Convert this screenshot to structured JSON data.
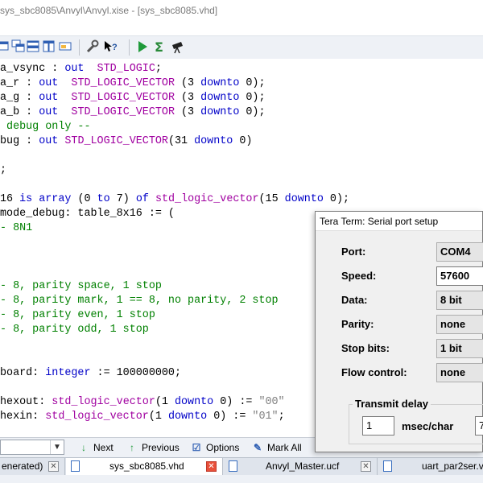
{
  "window": {
    "title": "sys_sbc8085\\Anvyl\\Anvyl.xise - [sys_sbc8085.vhd]"
  },
  "toolbar": {
    "icons": [
      "cascade-windows-icon",
      "tile-horizontal-icon",
      "tile-vertical-icon",
      "arrange-icon",
      "settings-wrench-icon",
      "help-pointer-icon",
      "run-icon",
      "sigma-icon",
      "telescope-icon"
    ]
  },
  "code": {
    "lines": [
      [
        {
          "t": "a_vsync : ",
          "c": "plain"
        },
        {
          "t": "out",
          "c": "kw"
        },
        {
          "t": "  ",
          "c": "plain"
        },
        {
          "t": "STD_LOGIC",
          "c": "ty"
        },
        {
          "t": ";",
          "c": "plain"
        }
      ],
      [
        {
          "t": "a_r : ",
          "c": "plain"
        },
        {
          "t": "out",
          "c": "kw"
        },
        {
          "t": "  ",
          "c": "plain"
        },
        {
          "t": "STD_LOGIC_VECTOR",
          "c": "ty"
        },
        {
          "t": " (3 ",
          "c": "plain"
        },
        {
          "t": "downto",
          "c": "kw"
        },
        {
          "t": " 0);",
          "c": "plain"
        }
      ],
      [
        {
          "t": "a_g : ",
          "c": "plain"
        },
        {
          "t": "out",
          "c": "kw"
        },
        {
          "t": "  ",
          "c": "plain"
        },
        {
          "t": "STD_LOGIC_VECTOR",
          "c": "ty"
        },
        {
          "t": " (3 ",
          "c": "plain"
        },
        {
          "t": "downto",
          "c": "kw"
        },
        {
          "t": " 0);",
          "c": "plain"
        }
      ],
      [
        {
          "t": "a_b : ",
          "c": "plain"
        },
        {
          "t": "out",
          "c": "kw"
        },
        {
          "t": "  ",
          "c": "plain"
        },
        {
          "t": "STD_LOGIC_VECTOR",
          "c": "ty"
        },
        {
          "t": " (3 ",
          "c": "plain"
        },
        {
          "t": "downto",
          "c": "kw"
        },
        {
          "t": " 0);",
          "c": "plain"
        }
      ],
      [
        {
          "t": " debug only --",
          "c": "cm"
        }
      ],
      [
        {
          "t": "bug : ",
          "c": "plain"
        },
        {
          "t": "out",
          "c": "kw"
        },
        {
          "t": " ",
          "c": "plain"
        },
        {
          "t": "STD_LOGIC_VECTOR",
          "c": "ty"
        },
        {
          "t": "(31 ",
          "c": "plain"
        },
        {
          "t": "downto",
          "c": "kw"
        },
        {
          "t": " 0)",
          "c": "plain"
        }
      ],
      [],
      [
        {
          "t": ";",
          "c": "plain"
        }
      ],
      [],
      [
        {
          "t": "16 ",
          "c": "plain"
        },
        {
          "t": "is",
          "c": "kw"
        },
        {
          "t": " ",
          "c": "plain"
        },
        {
          "t": "array",
          "c": "kw"
        },
        {
          "t": " (0 ",
          "c": "plain"
        },
        {
          "t": "to",
          "c": "kw"
        },
        {
          "t": " 7) ",
          "c": "plain"
        },
        {
          "t": "of",
          "c": "kw"
        },
        {
          "t": " ",
          "c": "plain"
        },
        {
          "t": "std_logic_vector",
          "c": "ty"
        },
        {
          "t": "(15 ",
          "c": "plain"
        },
        {
          "t": "downto",
          "c": "kw"
        },
        {
          "t": " 0);",
          "c": "plain"
        }
      ],
      [
        {
          "t": "mode_debug: table_8x16 := (",
          "c": "plain"
        }
      ],
      [
        {
          "t": "- 8N1",
          "c": "cm"
        }
      ],
      [],
      [],
      [],
      [
        {
          "t": "- 8, parity space, 1 stop",
          "c": "cm"
        }
      ],
      [
        {
          "t": "- 8, parity mark, 1 == 8, no parity, 2 stop",
          "c": "cm"
        }
      ],
      [
        {
          "t": "- 8, parity even, 1 stop",
          "c": "cm"
        }
      ],
      [
        {
          "t": "- 8, parity odd, 1 stop",
          "c": "cm"
        }
      ],
      [],
      [],
      [
        {
          "t": "board: ",
          "c": "plain"
        },
        {
          "t": "integer",
          "c": "kw"
        },
        {
          "t": " := 100000000;",
          "c": "plain"
        }
      ],
      [],
      [
        {
          "t": "hexout: ",
          "c": "plain"
        },
        {
          "t": "std_logic_vector",
          "c": "ty"
        },
        {
          "t": "(1 ",
          "c": "plain"
        },
        {
          "t": "downto",
          "c": "kw"
        },
        {
          "t": " 0) := ",
          "c": "plain"
        },
        {
          "t": "\"00\"",
          "c": "str"
        }
      ],
      [
        {
          "t": "hexin: ",
          "c": "plain"
        },
        {
          "t": "std_logic_vector",
          "c": "ty"
        },
        {
          "t": "(1 ",
          "c": "plain"
        },
        {
          "t": "downto",
          "c": "kw"
        },
        {
          "t": " 0) := ",
          "c": "plain"
        },
        {
          "t": "\"01\"",
          "c": "str"
        },
        {
          "t": ";",
          "c": "plain"
        }
      ]
    ]
  },
  "findbar": {
    "next_label": "Next",
    "previous_label": "Previous",
    "options_label": "Options",
    "markall_label": "Mark All"
  },
  "tabs": [
    {
      "label": "enerated)",
      "close": "normal"
    },
    {
      "label": "sys_sbc8085.vhd",
      "close": "red",
      "active": true
    },
    {
      "label": "Anvyl_Master.ucf",
      "close": "normal"
    },
    {
      "label": "uart_par2ser.vhd",
      "close": "none"
    }
  ],
  "dialog": {
    "title": "Tera Term: Serial port setup",
    "rows": [
      {
        "label": "Port:",
        "value": "COM4",
        "kind": "combo"
      },
      {
        "label": "Speed:",
        "value": "57600",
        "kind": "edit"
      },
      {
        "label": "Data:",
        "value": "8 bit",
        "kind": "combo"
      },
      {
        "label": "Parity:",
        "value": "none",
        "kind": "combo"
      },
      {
        "label": "Stop bits:",
        "value": "1 bit",
        "kind": "combo"
      },
      {
        "label": "Flow control:",
        "value": "none",
        "kind": "combo"
      }
    ],
    "transmit_delay": {
      "label": "Transmit delay",
      "char_value": "1",
      "char_unit": "msec/char",
      "line_value": "7"
    }
  }
}
